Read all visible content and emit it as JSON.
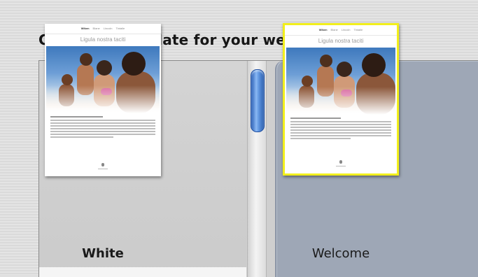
{
  "heading": "Choose a template for your webpage:",
  "templates": [
    {
      "name": "White",
      "selected": false,
      "preview": {
        "nav": [
          "Wiken",
          "Blane",
          "Lincoln",
          "Tintalle"
        ],
        "title": "Ligula nostra taciti"
      }
    },
    {
      "name": "Welcome",
      "selected": true,
      "preview": {
        "nav": [
          "Wiken",
          "Blane",
          "Lincoln",
          "Tintalle"
        ],
        "title": "Ligula nostra taciti"
      }
    }
  ],
  "colors": {
    "selection_background": "#9ea7b6",
    "selection_border": "#f2ef1c",
    "scroll_thumb": "#3f78d0"
  },
  "icons": {
    "scroll_thumb": "aqua-scroll-thumb"
  }
}
